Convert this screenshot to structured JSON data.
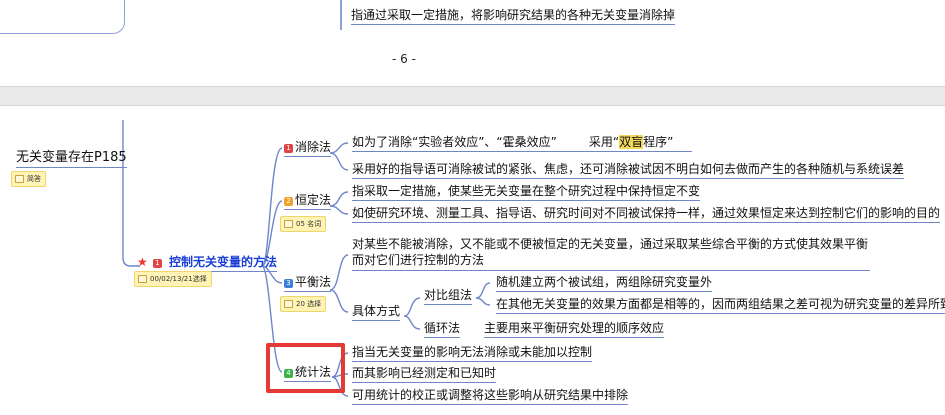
{
  "prev_page": {
    "text_line": "指通过采取一定措施，将影响研究结果的各种无关变量消除掉",
    "page_number": "- 6 -"
  },
  "root": {
    "label": "无关变量存在P185",
    "note": "简答"
  },
  "main": {
    "star": "★",
    "badge": "1",
    "label": "控制无关变量的方法",
    "note": "00/02/13/21选择"
  },
  "branches": {
    "elimination": {
      "badge": "1",
      "label": "消除法",
      "item1_a": "如为了消除“实验者效应”、“霍桑效应”",
      "item1_b": "采用“",
      "item1_hl": "双盲",
      "item1_c": "程序”",
      "item2": "采用好的指导语可消除被试的紧张、焦虑，还可消除被试因不明白如何去做而产生的各种随机与系统误差"
    },
    "constancy": {
      "badge": "2",
      "label": "恒定法",
      "note": "05 名词",
      "item1": "指采取一定措施，使某些无关变量在整个研究过程中保持恒定不变",
      "item2": "如使研究环境、测量工具、指导语、研究时间对不同被试保持一样，通过效果恒定来达到控制它们的影响的目的"
    },
    "balancing": {
      "badge": "3",
      "label": "平衡法",
      "note": "20 选择",
      "item1": "对某些不能被消除，又不能或不便被恒定的无关变量，通过采取某些综合平衡的方式使其效果平衡而对它们进行控制的方法",
      "specific": "具体方式",
      "contrast_label": "对比组法",
      "contrast_1": "随机建立两个被试组，两组除研究变量外",
      "contrast_2": "在其他无关变量的效果方面都是相等的，因而两组结果之差可视为研究变量的差异所致",
      "cycle_label": "循环法",
      "cycle_1": "主要用来平衡研究处理的顺序效应"
    },
    "statistics": {
      "badge": "4",
      "label": "统计法",
      "item1": "指当无关变量的影响无法消除或未能加以控制",
      "item2": "而其影响已经测定和已知时",
      "item3": "可用统计的校正或调整将这些影响从研究结果中排除"
    }
  },
  "colors": {
    "branch_line": "#6f86c9",
    "highlight_box": "#e53935",
    "main_topic": "#1a3fd6"
  }
}
